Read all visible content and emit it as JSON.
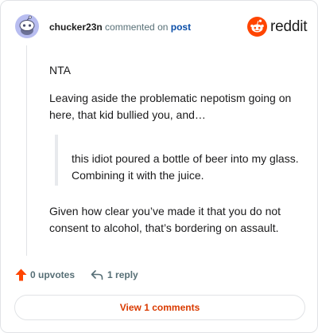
{
  "comment": {
    "author": "chucker23n",
    "action_text": " commented on ",
    "post_link": "post",
    "paragraphs": [
      "NTA",
      "Leaving aside the problematic nepotism going on here, that kid bullied you, and…",
      "Given how clear you’ve made it that you do not consent to alcohol, that’s bordering on assault."
    ],
    "quote": "this idiot poured a bottle of beer into my glass. Combining it with the juice."
  },
  "brand": {
    "wordmark": "reddit",
    "color": "#ff4500"
  },
  "actions": {
    "upvotes_label": "0 upvotes",
    "replies_label": "1 reply"
  },
  "view_comments_label": "View 1 comments",
  "colors": {
    "upvote": "#ff4500",
    "link": "#0a4ea8",
    "view_button_text": "#d93a00",
    "avatar_bg": "#b8bdf0"
  },
  "icons": {
    "avatar": "snoo-avatar",
    "logo": "reddit-snoo-icon",
    "upvote": "arrow-up-icon",
    "reply": "reply-arrow-icon"
  }
}
